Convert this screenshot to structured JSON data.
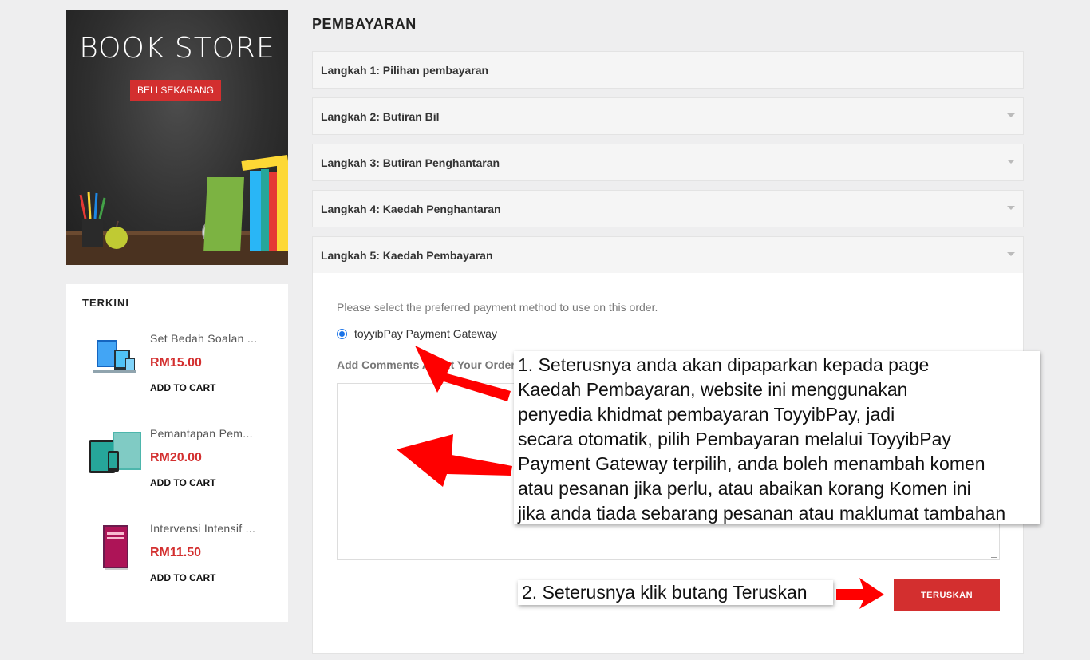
{
  "banner": {
    "title": "BOOK STORE",
    "button_label": "BELI SEKARANG"
  },
  "sidebar": {
    "title": "TERKINI",
    "products": [
      {
        "name": "Set Bedah Soalan ...",
        "price": "RM15.00",
        "cart_label": "ADD TO CART"
      },
      {
        "name": "Pemantapan Pem...",
        "price": "RM20.00",
        "cart_label": "ADD TO CART"
      },
      {
        "name": "Intervensi Intensif ...",
        "price": "RM11.50",
        "cart_label": "ADD TO CART"
      }
    ]
  },
  "page_title": "PEMBAYARAN",
  "steps": [
    {
      "label": "Langkah 1: Pilihan pembayaran",
      "has_caret": false
    },
    {
      "label": "Langkah 2: Butiran Bil",
      "has_caret": true
    },
    {
      "label": "Langkah 3: Butiran Penghantaran",
      "has_caret": true
    },
    {
      "label": "Langkah 4: Kaedah Penghantaran",
      "has_caret": true
    },
    {
      "label": "Langkah 5: Kaedah Pembayaran",
      "has_caret": true
    }
  ],
  "payment": {
    "instruction": "Please select the preferred payment method to use on this order.",
    "option_label": "toyyibPay Payment Gateway",
    "option_selected": true,
    "comment_label": "Add Comments About Your Order",
    "comment_value": "",
    "continue_label": "TERUSKAN"
  },
  "annotations": {
    "note1_lines": [
      "1. Seterusnya anda akan dipaparkan kepada page",
      "Kaedah Pembayaran, website ini menggunakan",
      "penyedia khidmat pembayaran ToyyibPay, jadi",
      "secara otomatik, pilih Pembayaran melalui ToyyibPay",
      "Payment Gateway terpilih, anda boleh menambah komen",
      "atau pesanan jika perlu, atau abaikan korang Komen ini",
      "jika anda tiada sebarang pesanan atau maklumat tambahan"
    ],
    "note2": "2. Seterusnya klik butang Teruskan"
  },
  "colors": {
    "accent": "#d32f2f",
    "arrow": "#ff0000",
    "background": "#eeeeef"
  }
}
